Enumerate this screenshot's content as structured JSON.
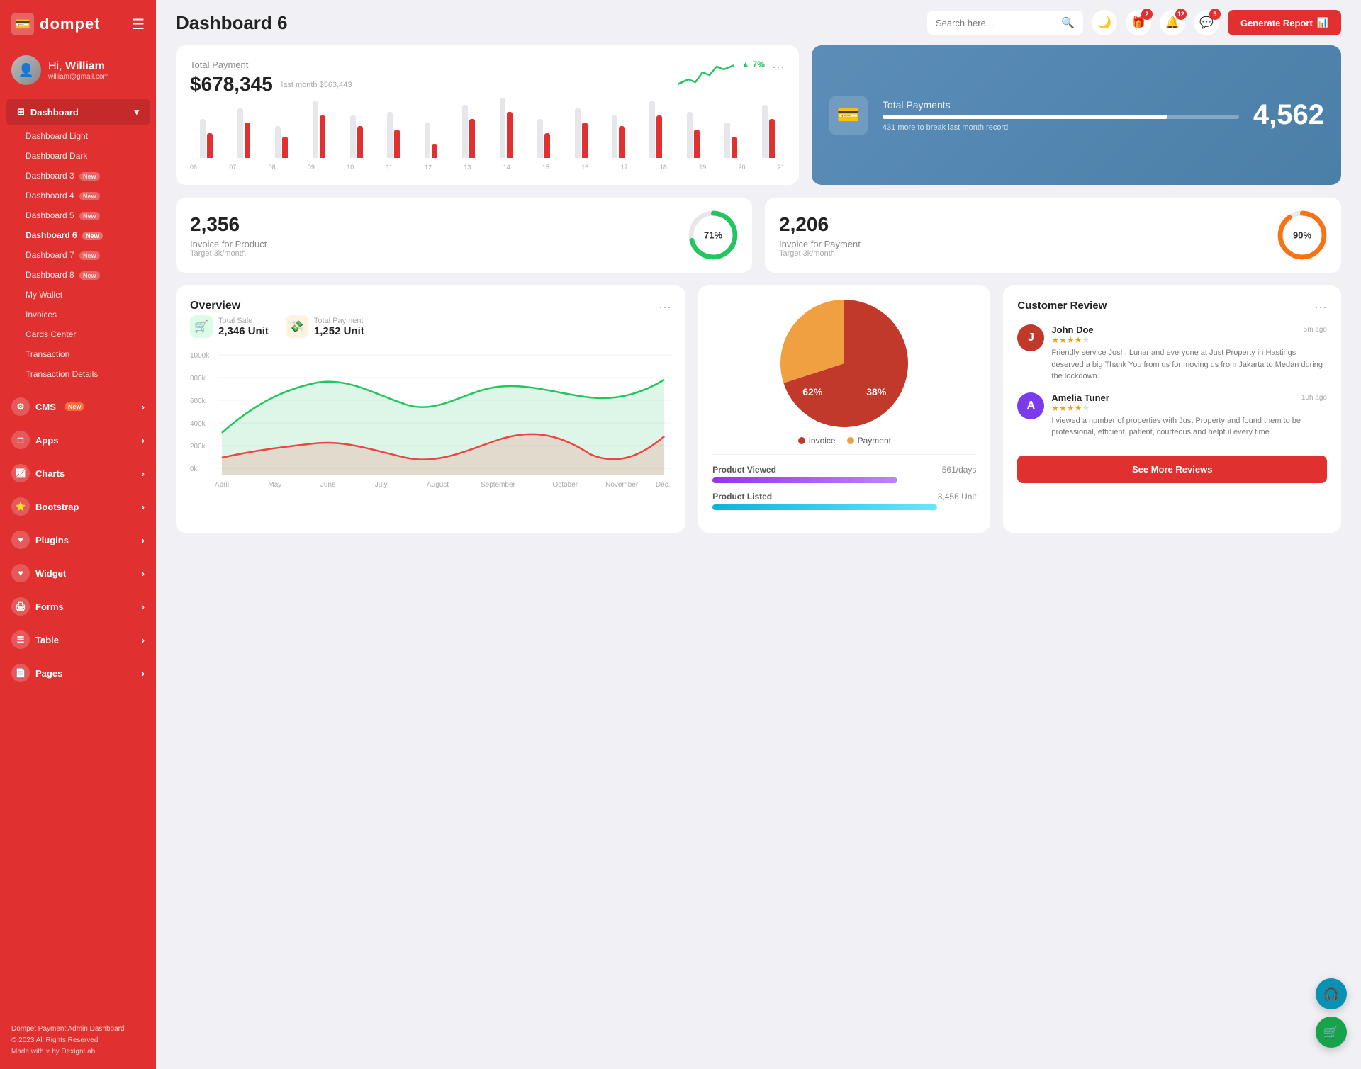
{
  "sidebar": {
    "logo": "dompet",
    "logo_icon": "💳",
    "hamburger_icon": "☰",
    "user": {
      "greeting": "Hi,",
      "name": "William",
      "email": "william@gmail.com"
    },
    "dashboard_section": {
      "label": "Dashboard",
      "icon": "⊞",
      "items": [
        {
          "label": "Dashboard Light",
          "active": false,
          "badge": ""
        },
        {
          "label": "Dashboard Dark",
          "active": false,
          "badge": ""
        },
        {
          "label": "Dashboard 3",
          "active": false,
          "badge": "New"
        },
        {
          "label": "Dashboard 4",
          "active": false,
          "badge": "New"
        },
        {
          "label": "Dashboard 5",
          "active": false,
          "badge": "New"
        },
        {
          "label": "Dashboard 6",
          "active": true,
          "badge": "New"
        },
        {
          "label": "Dashboard 7",
          "active": false,
          "badge": "New"
        },
        {
          "label": "Dashboard 8",
          "active": false,
          "badge": "New"
        },
        {
          "label": "My Wallet",
          "active": false,
          "badge": ""
        },
        {
          "label": "Invoices",
          "active": false,
          "badge": ""
        },
        {
          "label": "Cards Center",
          "active": false,
          "badge": ""
        },
        {
          "label": "Transaction",
          "active": false,
          "badge": ""
        },
        {
          "label": "Transaction Details",
          "active": false,
          "badge": ""
        }
      ]
    },
    "nav_items": [
      {
        "label": "CMS",
        "icon": "⚙",
        "badge": "New",
        "has_arrow": true
      },
      {
        "label": "Apps",
        "icon": "◻",
        "badge": "",
        "has_arrow": true
      },
      {
        "label": "Charts",
        "icon": "📈",
        "badge": "",
        "has_arrow": true
      },
      {
        "label": "Bootstrap",
        "icon": "⭐",
        "badge": "",
        "has_arrow": true
      },
      {
        "label": "Plugins",
        "icon": "♡",
        "badge": "",
        "has_arrow": true
      },
      {
        "label": "Widget",
        "icon": "♡",
        "badge": "",
        "has_arrow": true
      },
      {
        "label": "Forms",
        "icon": "🖨",
        "badge": "",
        "has_arrow": true
      },
      {
        "label": "Table",
        "icon": "☰",
        "badge": "",
        "has_arrow": true
      },
      {
        "label": "Pages",
        "icon": "📄",
        "badge": "",
        "has_arrow": true
      }
    ],
    "footer": {
      "line1": "Dompet Payment Admin Dashboard",
      "line2": "© 2023 All Rights Reserved",
      "line3": "Made with ♥ by DexignLab"
    }
  },
  "topbar": {
    "page_title": "Dashboard 6",
    "search_placeholder": "Search here...",
    "icons": {
      "theme_icon": "🌙",
      "gift_badge": "2",
      "bell_badge": "12",
      "chat_badge": "5"
    },
    "generate_btn": "Generate Report"
  },
  "total_payment": {
    "label": "Total Payment",
    "value": "$678,345",
    "sub": "last month $563,443",
    "trend": "7%",
    "trend_arrow": "▲",
    "more": "...",
    "bars": [
      {
        "gray": 55,
        "red": 35
      },
      {
        "gray": 70,
        "red": 50
      },
      {
        "gray": 45,
        "red": 30
      },
      {
        "gray": 80,
        "red": 60
      },
      {
        "gray": 60,
        "red": 45
      },
      {
        "gray": 65,
        "red": 40
      },
      {
        "gray": 50,
        "red": 20
      },
      {
        "gray": 75,
        "red": 55
      },
      {
        "gray": 85,
        "red": 65
      },
      {
        "gray": 55,
        "red": 35
      },
      {
        "gray": 70,
        "red": 50
      },
      {
        "gray": 60,
        "red": 45
      },
      {
        "gray": 80,
        "red": 60
      },
      {
        "gray": 65,
        "red": 40
      },
      {
        "gray": 50,
        "red": 30
      },
      {
        "gray": 75,
        "red": 55
      }
    ],
    "x_labels": [
      "06",
      "07",
      "08",
      "09",
      "10",
      "11",
      "12",
      "13",
      "14",
      "15",
      "16",
      "17",
      "18",
      "19",
      "20",
      "21"
    ]
  },
  "total_payments_blue": {
    "label": "Total Payments",
    "sub": "431 more to break last month record",
    "number": "4,562",
    "progress": 80,
    "icon": "💳"
  },
  "invoice_product": {
    "value": "2,356",
    "label": "Invoice for Product",
    "sub": "Target 3k/month",
    "percent": 71,
    "color": "#22c55e"
  },
  "invoice_payment": {
    "value": "2,206",
    "label": "Invoice for Payment",
    "sub": "Target 3k/month",
    "percent": 90,
    "color": "#f97316"
  },
  "overview": {
    "title": "Overview",
    "total_sale": {
      "label": "Total Sale",
      "value": "2,346 Unit"
    },
    "total_payment": {
      "label": "Total Payment",
      "value": "1,252 Unit"
    },
    "y_labels": [
      "1000k",
      "800k",
      "600k",
      "400k",
      "200k",
      "0k"
    ],
    "x_labels": [
      "April",
      "May",
      "June",
      "July",
      "August",
      "September",
      "October",
      "November",
      "Dec."
    ]
  },
  "pie_chart": {
    "invoice_pct": 62,
    "payment_pct": 38,
    "invoice_label": "Invoice",
    "payment_label": "Payment",
    "invoice_color": "#c0392b",
    "payment_color": "#f0a040"
  },
  "product_stats": {
    "viewed": {
      "label": "Product Viewed",
      "value": "561/days"
    },
    "listed": {
      "label": "Product Listed",
      "value": "3,456 Unit"
    }
  },
  "customer_review": {
    "title": "Customer Review",
    "reviews": [
      {
        "name": "John Doe",
        "stars": 4,
        "time": "5m ago",
        "text": "Friendly service Josh, Lunar and everyone at Just Property in Hastings deserved a big Thank You from us for moving us from Jakarta to Medan during the lockdown.",
        "avatar_color": "#c0392b",
        "initials": "J"
      },
      {
        "name": "Amelia Tuner",
        "stars": 4,
        "time": "10h ago",
        "text": "I viewed a number of properties with Just Property and found them to be professional, efficient, patient, courteous and helpful every time.",
        "avatar_color": "#7c3aed",
        "initials": "A"
      }
    ],
    "see_more_label": "See More Reviews"
  }
}
